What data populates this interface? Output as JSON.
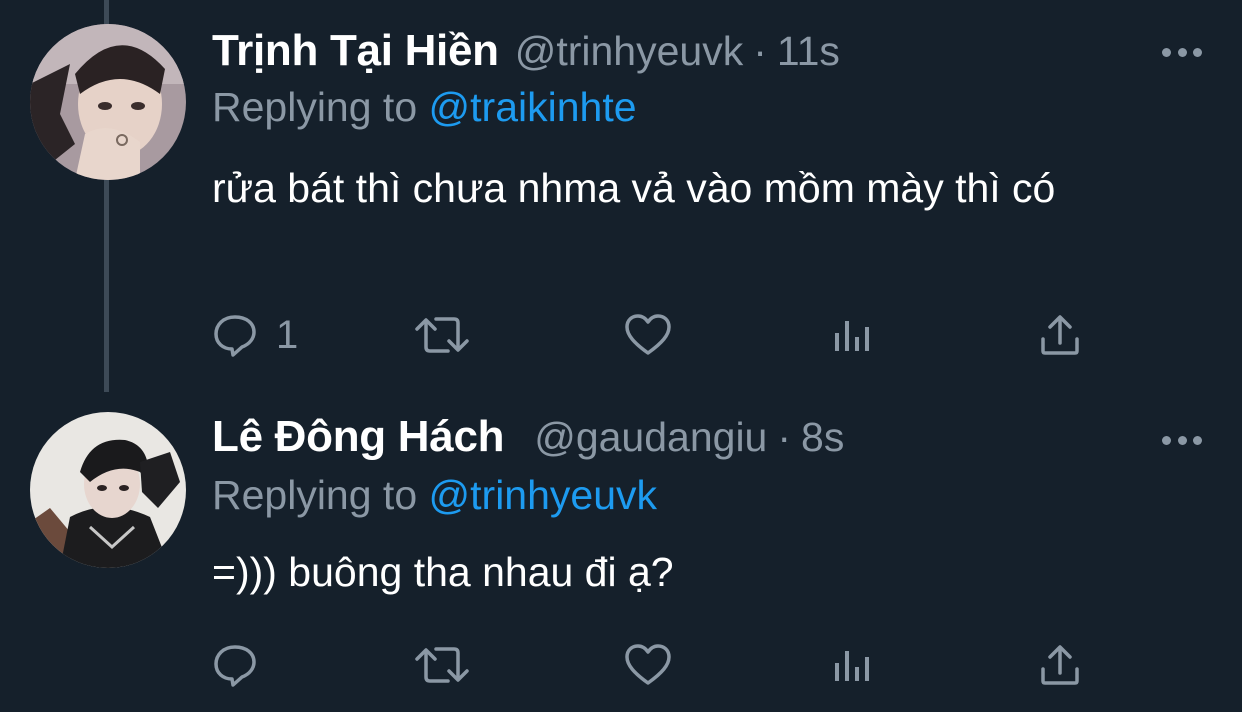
{
  "tweets": [
    {
      "display_name": "Trịnh Tại Hiền",
      "handle": "@trinhyeuvk",
      "separator": "·",
      "time": "11s",
      "replying_prefix": "Replying to",
      "replying_to": "@traikinhte",
      "text": "rửa bát thì chưa nhma vả vào mồm mày thì có",
      "reply_count": "1"
    },
    {
      "display_name": "Lê Đông Hách",
      "handle": "@gaudangiu",
      "separator": "·",
      "time": "8s",
      "replying_prefix": "Replying to",
      "replying_to": "@trinhyeuvk",
      "text": "=))) buông tha nhau đi ạ?",
      "reply_count": ""
    }
  ],
  "icons": {
    "reply": "reply-icon",
    "retweet": "retweet-icon",
    "like": "heart-icon",
    "views": "views-icon",
    "share": "share-icon",
    "more": "more-icon"
  },
  "colors": {
    "background": "#15202b",
    "text": "#ffffff",
    "secondary": "#8b98a5",
    "accent": "#1d9bf0",
    "thread_line": "#3d4a57"
  }
}
